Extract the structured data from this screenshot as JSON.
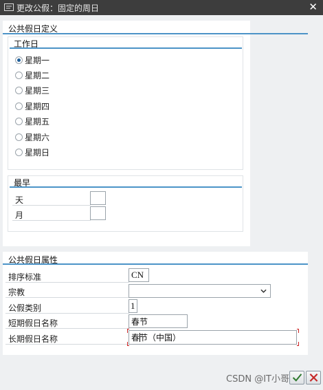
{
  "window": {
    "title": "更改公假：固定的周日",
    "close_glyph": "✕"
  },
  "definition": {
    "title": "公共假日定义",
    "workday": {
      "title": "工作日",
      "options": [
        "星期一",
        "星期二",
        "星期三",
        "星期四",
        "星期五",
        "星期六",
        "星期日"
      ],
      "selected_index": 0
    },
    "earliest": {
      "title": "最早",
      "fields": [
        {
          "label": "天",
          "value": ""
        },
        {
          "label": "月",
          "value": ""
        }
      ]
    }
  },
  "attributes": {
    "title": "公共假日属性",
    "sort_label": "排序标准",
    "sort_value": "CN",
    "religion_label": "宗教",
    "religion_value": "",
    "category_label": "公假类别",
    "category_value": "1",
    "short_label": "短期假日名称",
    "short_value": "春节",
    "long_label": "长期假日名称",
    "long_value": "春节（中国）"
  },
  "watermark": "CSDN @IT小哥员",
  "icons": {
    "confirm": "check-icon",
    "cancel": "cancel-icon",
    "close": "close-icon"
  }
}
